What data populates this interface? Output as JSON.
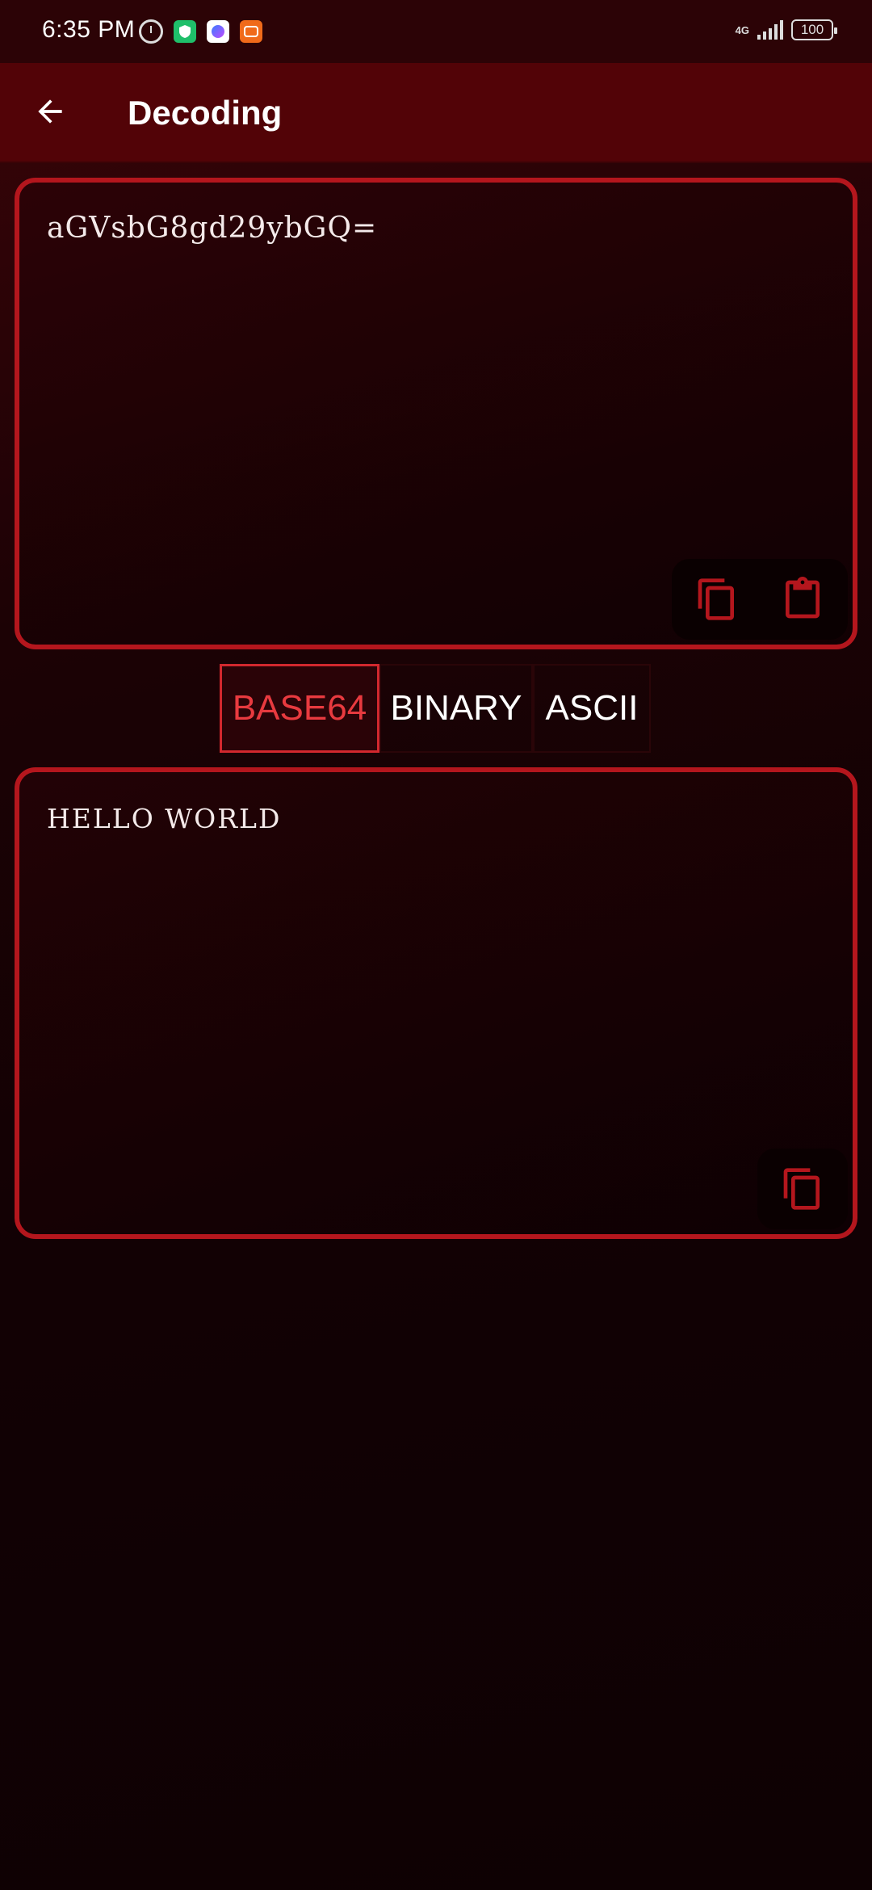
{
  "status_bar": {
    "time": "6:35 PM",
    "network": "4G",
    "battery": "100",
    "notification_icons": [
      "alarm-icon",
      "shield-app-icon",
      "messenger-icon",
      "orange-app-icon"
    ]
  },
  "app_bar": {
    "title": "Decoding",
    "back_icon": "arrow-left-icon"
  },
  "input_panel": {
    "text": "aGVsbG8gd29ybGQ=",
    "actions": [
      "copy-icon",
      "paste-icon"
    ]
  },
  "modes": {
    "options": [
      "BASE64",
      "BINARY",
      "ASCII"
    ],
    "selected": "BASE64"
  },
  "output_panel": {
    "text": "HELLO WORLD",
    "actions": [
      "copy-icon"
    ]
  },
  "colors": {
    "accent": "#b4161d",
    "active_text": "#e83a3f",
    "app_bar": "#520307",
    "background": "#120104"
  }
}
